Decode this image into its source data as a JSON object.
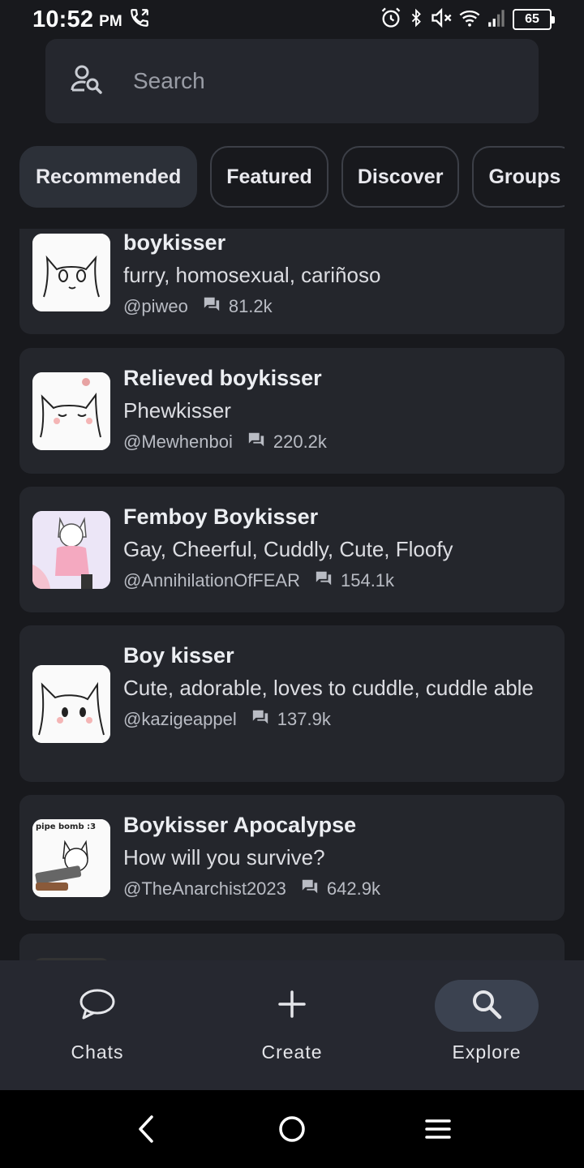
{
  "status_bar": {
    "time": "10:52",
    "ampm": "PM",
    "battery": "65",
    "icons": [
      "call-icon",
      "alarm-icon",
      "bluetooth-icon",
      "mute-icon",
      "wifi-icon",
      "signal-icon",
      "battery-icon"
    ]
  },
  "search": {
    "placeholder": "Search",
    "icon": "user-search-icon"
  },
  "tabs": [
    {
      "label": "Recommended",
      "active": true
    },
    {
      "label": "Featured",
      "active": false
    },
    {
      "label": "Discover",
      "active": false
    },
    {
      "label": "Groups",
      "active": false
    }
  ],
  "characters": [
    {
      "name": "boykisser",
      "description": "furry, homosexual, cariñoso",
      "creator": "@piweo",
      "chats": "81.2k"
    },
    {
      "name": "Relieved boykisser",
      "description": "Phewkisser",
      "creator": "@Mewhenboi",
      "chats": "220.2k"
    },
    {
      "name": "Femboy Boykisser",
      "description": "Gay, Cheerful, Cuddly, Cute, Floofy",
      "creator": "@AnnihilationOfFEAR",
      "chats": "154.1k"
    },
    {
      "name": "Boy kisser",
      "description": "Cute, adorable, loves to cuddle, cuddle able",
      "creator": "@kazigeappel",
      "chats": "137.9k"
    },
    {
      "name": "Boykisser Apocalypse",
      "description": "How will you survive?",
      "creator": "@TheAnarchist2023",
      "chats": "642.9k",
      "avatar_caption": "pipe bomb :3"
    }
  ],
  "bottom_nav": [
    {
      "label": "Chats",
      "icon": "chat-bubble-icon",
      "active": false
    },
    {
      "label": "Create",
      "icon": "plus-icon",
      "active": false
    },
    {
      "label": "Explore",
      "icon": "search-icon",
      "active": true
    }
  ],
  "system_nav": [
    "back-icon",
    "home-icon",
    "menu-icon"
  ],
  "colors": {
    "background": "#18191d",
    "card": "#24262c",
    "nav": "#262830",
    "active_pill": "#3b4250"
  }
}
